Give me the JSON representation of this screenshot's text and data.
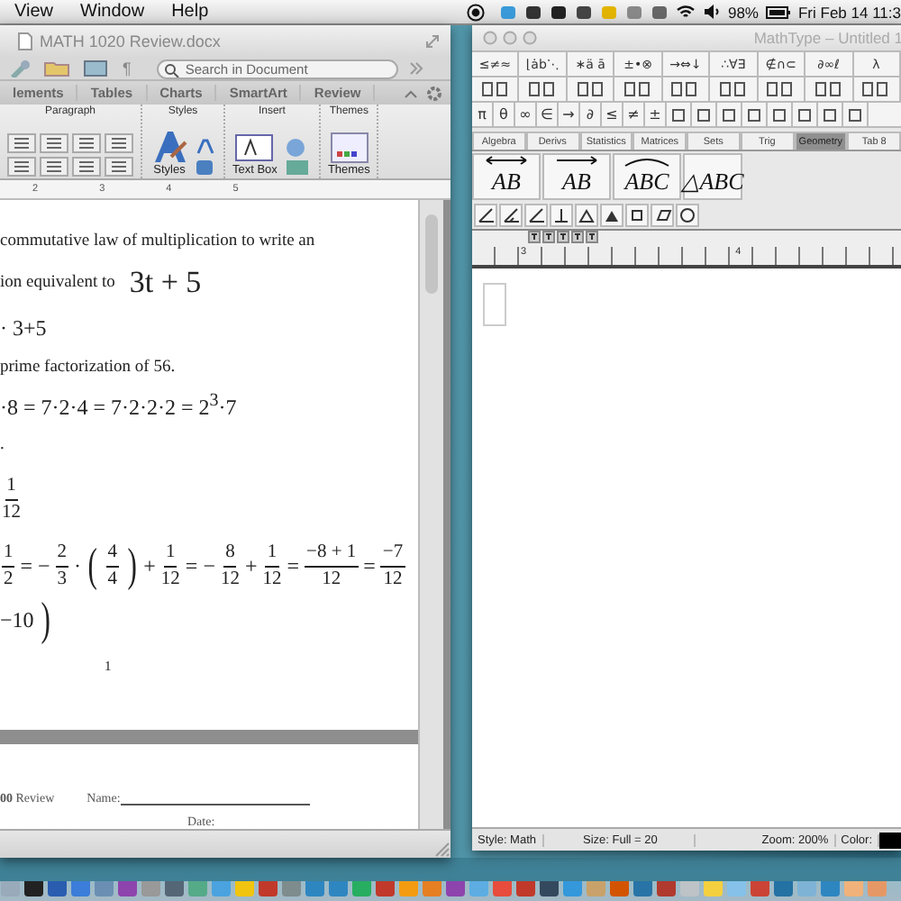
{
  "menubar": {
    "menus": [
      "View",
      "Window",
      "Help"
    ],
    "battery": "98%",
    "clock": "Fri Feb 14 11:3"
  },
  "word": {
    "title": "MATH 1020 Review.docx",
    "toolbar_glyph": "¶",
    "search": {
      "placeholder": "Search in Document"
    },
    "tabs": [
      {
        "label": "lements"
      },
      {
        "label": "Tables"
      },
      {
        "label": "Charts"
      },
      {
        "label": "SmartArt"
      },
      {
        "label": "Review"
      }
    ],
    "groups": [
      {
        "kind": "paragraph",
        "label": "Paragraph"
      },
      {
        "kind": "styles",
        "label": "Styles",
        "button": "Styles"
      },
      {
        "kind": "insert",
        "label": "Insert",
        "button": "Text Box"
      },
      {
        "kind": "themes",
        "label": "Themes",
        "button": "Themes"
      }
    ],
    "ruler": [
      "2",
      "3",
      "4",
      "5"
    ],
    "page": {
      "lines": [
        {
          "kind": "text",
          "text": "commutative law of multiplication to write an"
        },
        {
          "kind": "text_math",
          "text": "ion equivalent to",
          "math": "3t + 5"
        },
        {
          "kind": "math",
          "tokens": [
            {
              "kind": "op",
              "text": "· 3+5"
            }
          ]
        },
        {
          "kind": "text",
          "text": "prime factorization of 56."
        },
        {
          "kind": "math",
          "tokens": [
            {
              "kind": "op",
              "text": "·8 = 7·2·4 = 7·2·2·2 = 2$^{3}$·7"
            }
          ]
        },
        {
          "kind": "text",
          "text": "."
        },
        {
          "kind": "math",
          "tokens": [
            {
              "kind": "frac",
              "num": "1",
              "den": "12"
            }
          ]
        },
        {
          "kind": "math",
          "tokens": [
            {
              "kind": "frac",
              "num": "1",
              "den": "2"
            },
            {
              "kind": "op",
              "text": "= −"
            },
            {
              "kind": "frac",
              "num": "2",
              "den": "3"
            },
            {
              "kind": "op",
              "text": "·"
            },
            {
              "kind": "paren",
              "text": "("
            },
            {
              "kind": "frac",
              "num": "4",
              "den": "4"
            },
            {
              "kind": "paren",
              "text": ")"
            },
            {
              "kind": "op",
              "text": "+"
            },
            {
              "kind": "frac",
              "num": "1",
              "den": "12"
            },
            {
              "kind": "op",
              "text": "= −"
            },
            {
              "kind": "frac",
              "num": "8",
              "den": "12"
            },
            {
              "kind": "op",
              "text": "+"
            },
            {
              "kind": "frac",
              "num": "1",
              "den": "12"
            },
            {
              "kind": "op",
              "text": "="
            },
            {
              "kind": "frac",
              "num": "−8 + 1",
              "den": "12"
            },
            {
              "kind": "op",
              "text": "="
            },
            {
              "kind": "frac",
              "num": "−7",
              "den": "12"
            }
          ]
        },
        {
          "kind": "math",
          "tokens": [
            {
              "kind": "op",
              "text": "−10"
            },
            {
              "kind": "paren",
              "text": ")"
            }
          ]
        }
      ],
      "page_number": "1"
    },
    "page2": {
      "course": "**00** Review",
      "name_label": "Name:",
      "date_label": "Date:"
    }
  },
  "mathtype": {
    "title": "MathType – Untitled 1",
    "symbol_row": [
      "≤≠≈",
      "⌊ȧb⋱",
      "∗ä ā",
      "±•⊗",
      "→⇔↓",
      "∴∀∃",
      "∉∩⊂",
      "∂∞ℓ",
      "λ"
    ],
    "symbol_keys": [
      "π",
      "θ",
      "∞",
      "∈",
      "→",
      "∂",
      "≤",
      "≠",
      "±"
    ],
    "tabs": [
      {
        "label": "Algebra",
        "selected": false
      },
      {
        "label": "Derivs",
        "selected": false
      },
      {
        "label": "Statistics",
        "selected": false
      },
      {
        "label": "Matrices",
        "selected": false
      },
      {
        "label": "Sets",
        "selected": false
      },
      {
        "label": "Trig",
        "selected": false
      },
      {
        "label": "Geometry",
        "selected": true
      },
      {
        "label": "Tab 8",
        "selected": false
      }
    ],
    "templates": [
      {
        "kind": "double_arrow",
        "text": "AB"
      },
      {
        "kind": "arrow",
        "text": "AB"
      },
      {
        "kind": "arc",
        "text": "ABC"
      },
      {
        "kind": "plain",
        "text": "△ABC"
      }
    ],
    "ruler": [
      "3",
      "4"
    ],
    "status": [
      "Style: Math",
      "Size: Full = 20",
      "Zoom: 200%",
      "Color:"
    ]
  }
}
